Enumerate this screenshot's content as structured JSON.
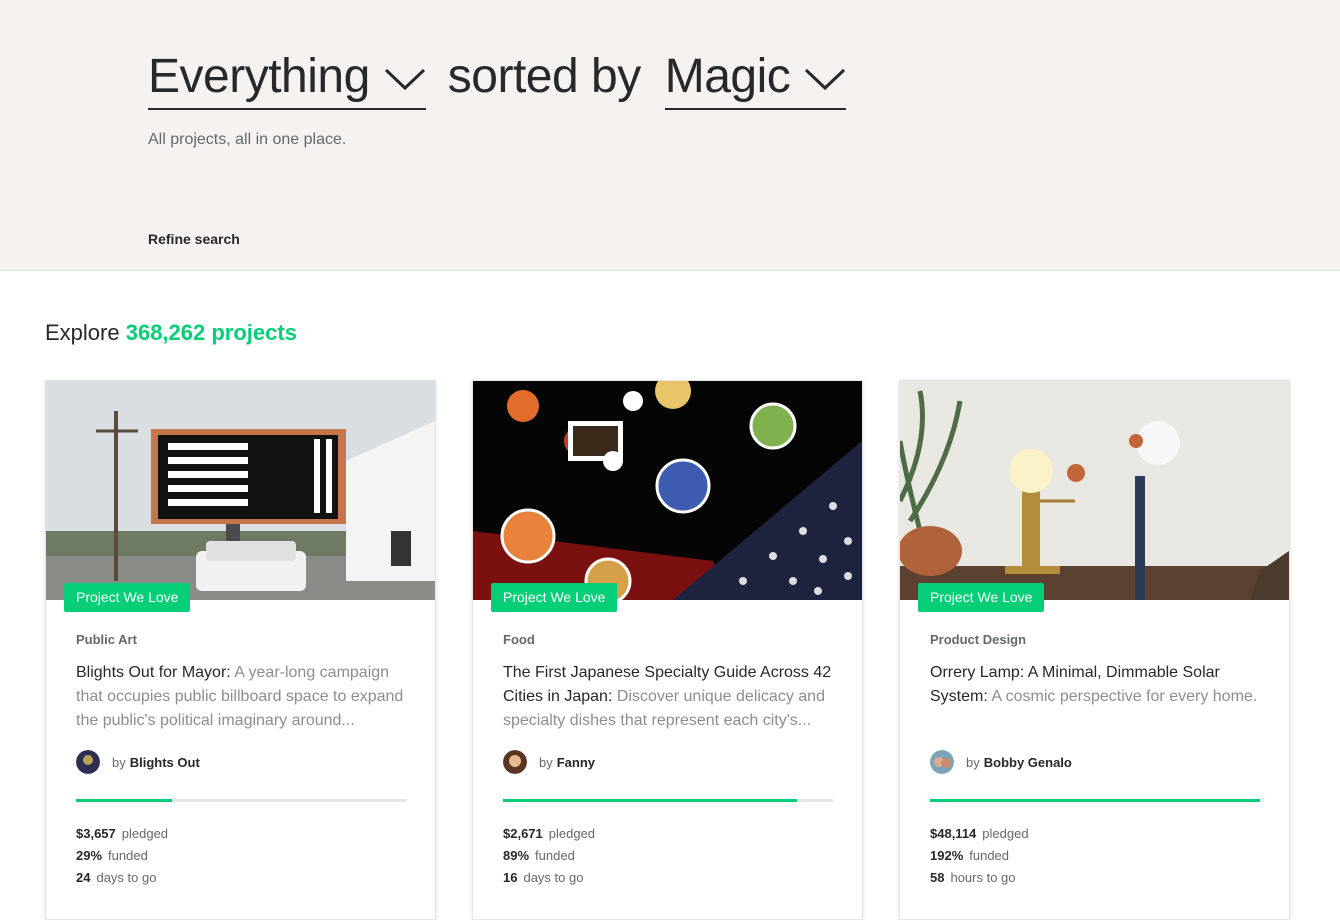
{
  "header": {
    "filter_value": "Everything",
    "sorted_by_label": "sorted by",
    "sort_value": "Magic",
    "subtitle": "All projects, all in one place.",
    "refine_label": "Refine search"
  },
  "explore": {
    "prefix": "Explore",
    "count_text": "368,262 projects"
  },
  "colors": {
    "accent": "#05ce78",
    "hero_bg": "#f5f2ef",
    "text": "#282828"
  },
  "cards": [
    {
      "badge": "Project We Love",
      "category": "Public Art",
      "title": "Blights Out for Mayor:",
      "blurb": "A year-long campaign that occupies public billboard space to expand the public's political imaginary around...",
      "by_label": "by",
      "creator": "Blights Out",
      "funded_fraction": 0.29,
      "pledged_amount": "$3,657",
      "pledged_label": "pledged",
      "funded_percent": "29%",
      "funded_label": "funded",
      "time_value": "24",
      "time_label": "days to go"
    },
    {
      "badge": "Project We Love",
      "category": "Food",
      "title": "The First Japanese Specialty Guide Across 42 Cities in Japan:",
      "blurb": "Discover unique delicacy and specialty dishes that represent each city's...",
      "by_label": "by",
      "creator": "Fanny",
      "funded_fraction": 0.89,
      "pledged_amount": "$2,671",
      "pledged_label": "pledged",
      "funded_percent": "89%",
      "funded_label": "funded",
      "time_value": "16",
      "time_label": "days to go"
    },
    {
      "badge": "Project We Love",
      "category": "Product Design",
      "title": "Orrery Lamp: A Minimal, Dimmable Solar System:",
      "blurb": "A cosmic perspective for every home.",
      "by_label": "by",
      "creator": "Bobby Genalo",
      "funded_fraction": 1.0,
      "pledged_amount": "$48,114",
      "pledged_label": "pledged",
      "funded_percent": "192%",
      "funded_label": "funded",
      "time_value": "58",
      "time_label": "hours to go"
    }
  ]
}
